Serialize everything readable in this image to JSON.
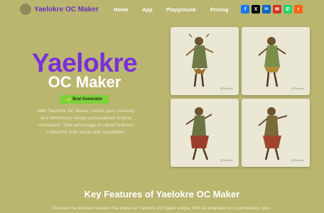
{
  "header": {
    "brand": "Yaelokre OC Maker",
    "logo_icon": "avatar-logo-icon",
    "nav": [
      {
        "label": "Home"
      },
      {
        "label": "App"
      },
      {
        "label": "Playground"
      },
      {
        "label": "Pricing"
      }
    ],
    "socials": [
      {
        "icon": "facebook-icon",
        "glyph": "f",
        "color": "#1877f2"
      },
      {
        "icon": "x-icon",
        "glyph": "X",
        "color": "#000000"
      },
      {
        "icon": "linkedin-icon",
        "glyph": "in",
        "color": "#0a66c2"
      },
      {
        "icon": "email-icon",
        "glyph": "✉",
        "color": "#d93025"
      },
      {
        "icon": "whatsapp-icon",
        "glyph": "✆",
        "color": "#25d366"
      },
      {
        "icon": "reddit-icon",
        "glyph": "r",
        "color": "#ff6314"
      }
    ]
  },
  "hero": {
    "title": "Yaelokre",
    "subtitle": "OC Maker",
    "button_label": "Brat Generator",
    "button_icon": "sparkle-icon",
    "description": "With Yaelokre OC Maker, unlock your creativity and effortlessly design personalized original characters. Take advantage of robust features crafted for both artists and storytellers."
  },
  "gallery": {
    "images": [
      {
        "icon": "character-illustration",
        "alt": "Character art 1"
      },
      {
        "icon": "character-illustration",
        "alt": "Character art 2"
      },
      {
        "icon": "character-illustration",
        "alt": "Character art 3"
      },
      {
        "icon": "character-illustration",
        "alt": "Character art 4"
      }
    ]
  },
  "features": {
    "title": "Key Features of Yaelokre OC Maker",
    "description": "Discover the standout features that make our Yaelokre OC Maker unique. With an emphasis on customization, user-"
  },
  "colors": {
    "background": "#bab56f",
    "brand": "#6a33c4",
    "accent_button": "#7dd13a"
  }
}
